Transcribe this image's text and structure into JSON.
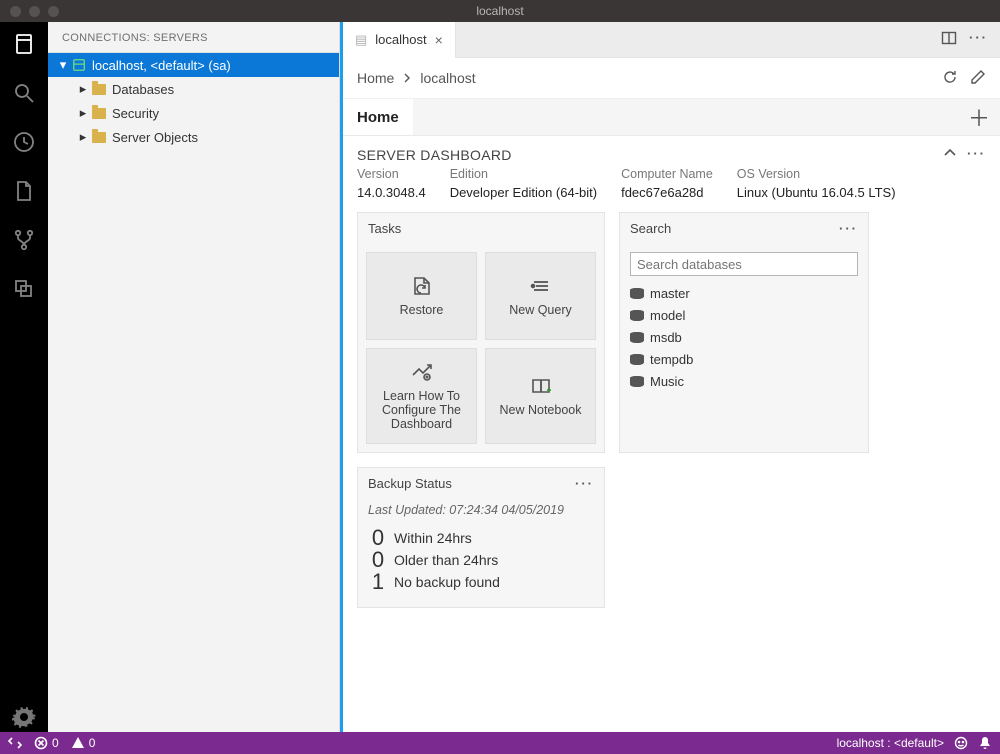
{
  "titlebar": {
    "title": "localhost"
  },
  "sidepanel": {
    "header": "CONNECTIONS: SERVERS",
    "server_label": "localhost, <default> (sa)",
    "children": [
      "Databases",
      "Security",
      "Server Objects"
    ]
  },
  "tabs": {
    "active": "localhost"
  },
  "breadcrumb": {
    "items": [
      "Home",
      "localhost"
    ]
  },
  "homeTab": {
    "label": "Home"
  },
  "dashboard": {
    "title": "SERVER DASHBOARD",
    "meta": {
      "version_label": "Version",
      "version_value": "14.0.3048.4",
      "edition_label": "Edition",
      "edition_value": "Developer Edition (64-bit)",
      "computer_label": "Computer Name",
      "computer_value": "fdec67e6a28d",
      "os_label": "OS Version",
      "os_value": "Linux (Ubuntu 16.04.5 LTS)"
    }
  },
  "tasks": {
    "title": "Tasks",
    "cards": [
      "Restore",
      "New Query",
      "Learn How To Configure The Dashboard",
      "New Notebook"
    ]
  },
  "search": {
    "title": "Search",
    "placeholder": "Search databases",
    "databases": [
      "master",
      "model",
      "msdb",
      "tempdb",
      "Music"
    ]
  },
  "backup": {
    "title": "Backup Status",
    "updated": "Last Updated: 07:24:34 04/05/2019",
    "rows": [
      {
        "count": "0",
        "label": "Within 24hrs"
      },
      {
        "count": "0",
        "label": "Older than 24hrs"
      },
      {
        "count": "1",
        "label": "No backup found"
      }
    ]
  },
  "statusbar": {
    "errors": "0",
    "warnings": "0",
    "connection": "localhost : <default>"
  }
}
